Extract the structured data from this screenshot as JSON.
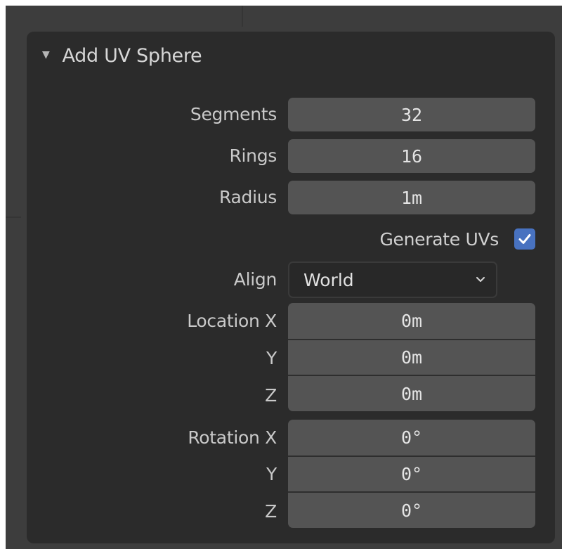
{
  "panel": {
    "title": "Add UV Sphere",
    "fields": {
      "segments": {
        "label": "Segments",
        "value": "32"
      },
      "rings": {
        "label": "Rings",
        "value": "16"
      },
      "radius": {
        "label": "Radius",
        "value": "1m"
      }
    },
    "generate_uvs": {
      "label": "Generate UVs",
      "checked": true
    },
    "align": {
      "label": "Align",
      "value": "World"
    },
    "location": {
      "x": {
        "label": "Location X",
        "value": "0m"
      },
      "y": {
        "label": "Y",
        "value": "0m"
      },
      "z": {
        "label": "Z",
        "value": "0m"
      }
    },
    "rotation": {
      "x": {
        "label": "Rotation X",
        "value": "0°"
      },
      "y": {
        "label": "Y",
        "value": "0°"
      },
      "z": {
        "label": "Z",
        "value": "0°"
      }
    }
  },
  "colors": {
    "panel_bg": "#2b2b2b",
    "field_bg": "#545454",
    "checkbox_accent": "#4872c0",
    "text": "#d6d6d6"
  },
  "icons": {
    "collapse": "triangle-down-icon",
    "checkbox": "checkmark-icon",
    "dropdown": "chevron-down-icon"
  }
}
